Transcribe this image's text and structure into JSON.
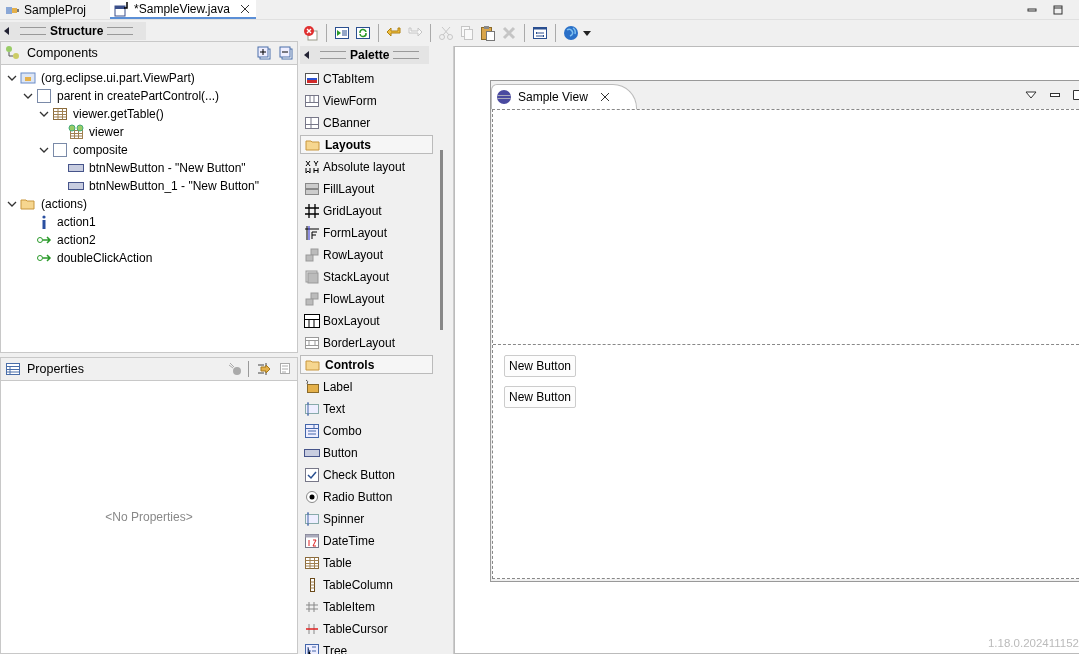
{
  "editor_tabs": [
    {
      "label": "SampleProj",
      "kind": "project",
      "selected": false,
      "closable": false
    },
    {
      "label": "*SampleView.java",
      "kind": "java",
      "selected": true,
      "closable": true
    }
  ],
  "structure": {
    "title": "Structure",
    "components": {
      "title": "Components",
      "tree": [
        {
          "label": "(org.eclipse.ui.part.ViewPart)",
          "kind": "viewpart",
          "expanded": true,
          "children": [
            {
              "label": "parent in createPartControl(...)",
              "kind": "composite",
              "expanded": true,
              "children": [
                {
                  "label": "viewer.getTable()",
                  "kind": "table",
                  "expanded": true,
                  "children": [
                    {
                      "label": "viewer",
                      "kind": "viewer"
                    }
                  ]
                },
                {
                  "label": "composite",
                  "kind": "composite",
                  "expanded": true,
                  "children": [
                    {
                      "label": "btnNewButton - \"New Button\"",
                      "kind": "button"
                    },
                    {
                      "label": "btnNewButton_1 - \"New Button\"",
                      "kind": "button"
                    }
                  ]
                }
              ]
            }
          ]
        },
        {
          "label": "(actions)",
          "kind": "folder",
          "expanded": true,
          "children": [
            {
              "label": "action1",
              "kind": "info"
            },
            {
              "label": "action2",
              "kind": "action"
            },
            {
              "label": "doubleClickAction",
              "kind": "action"
            }
          ]
        }
      ]
    },
    "properties": {
      "title": "Properties",
      "empty_text": "<No Properties>"
    }
  },
  "toolbar": [
    {
      "kind": "error",
      "disabled": false
    },
    {
      "kind": "sep"
    },
    {
      "kind": "test",
      "disabled": false
    },
    {
      "kind": "refresh",
      "disabled": false
    },
    {
      "kind": "sep"
    },
    {
      "kind": "undo",
      "disabled": false
    },
    {
      "kind": "redo",
      "disabled": true
    },
    {
      "kind": "sep"
    },
    {
      "kind": "cut",
      "disabled": true
    },
    {
      "kind": "copy",
      "disabled": true
    },
    {
      "kind": "paste",
      "disabled": false
    },
    {
      "kind": "delete",
      "disabled": true
    },
    {
      "kind": "sep"
    },
    {
      "kind": "form",
      "disabled": false
    },
    {
      "kind": "sep"
    },
    {
      "kind": "globe",
      "disabled": false
    }
  ],
  "palette": {
    "title": "Palette",
    "items": [
      {
        "label": "CTabItem",
        "kind": "ctabitem"
      },
      {
        "label": "ViewForm",
        "kind": "viewform"
      },
      {
        "label": "CBanner",
        "kind": "cbanner"
      },
      {
        "label": "Layouts",
        "kind": "category"
      },
      {
        "label": "Absolute layout",
        "kind": "absolute"
      },
      {
        "label": "FillLayout",
        "kind": "fill"
      },
      {
        "label": "GridLayout",
        "kind": "grid"
      },
      {
        "label": "FormLayout",
        "kind": "form"
      },
      {
        "label": "RowLayout",
        "kind": "row"
      },
      {
        "label": "StackLayout",
        "kind": "stack"
      },
      {
        "label": "FlowLayout",
        "kind": "row"
      },
      {
        "label": "BoxLayout",
        "kind": "box"
      },
      {
        "label": "BorderLayout",
        "kind": "border"
      },
      {
        "label": "Controls",
        "kind": "category"
      },
      {
        "label": "Label",
        "kind": "label"
      },
      {
        "label": "Text",
        "kind": "text"
      },
      {
        "label": "Combo",
        "kind": "combo"
      },
      {
        "label": "Button",
        "kind": "button"
      },
      {
        "label": "Check Button",
        "kind": "check"
      },
      {
        "label": "Radio Button",
        "kind": "radio"
      },
      {
        "label": "Spinner",
        "kind": "text"
      },
      {
        "label": "DateTime",
        "kind": "date"
      },
      {
        "label": "Table",
        "kind": "table"
      },
      {
        "label": "TableColumn",
        "kind": "column"
      },
      {
        "label": "TableItem",
        "kind": "tableitem"
      },
      {
        "label": "TableCursor",
        "kind": "cursor"
      },
      {
        "label": "Tree",
        "kind": "tree"
      }
    ]
  },
  "design": {
    "view_tab": "Sample View",
    "buttons": [
      "New Button",
      "New Button"
    ],
    "version": "1.18.0.202411152"
  }
}
